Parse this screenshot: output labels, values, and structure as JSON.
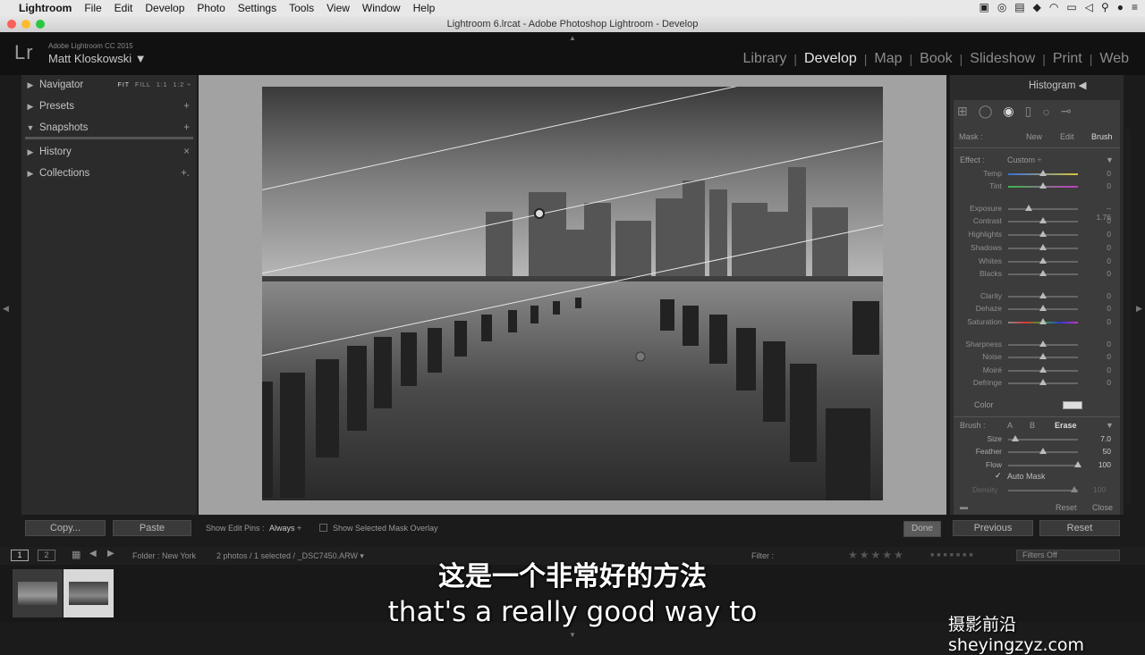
{
  "menubar": {
    "apple": "",
    "app": "Lightroom",
    "items": [
      "File",
      "Edit",
      "Develop",
      "Photo",
      "Settings",
      "Tools",
      "View",
      "Window",
      "Help"
    ]
  },
  "window": {
    "title": "Lightroom 6.lrcat - Adobe Photoshop Lightroom - Develop"
  },
  "identity": {
    "logo": "Lr",
    "product": "Adobe Lightroom CC 2015",
    "user": "Matt Kloskowski ▼"
  },
  "modules": [
    "Library",
    "Develop",
    "Map",
    "Book",
    "Slideshow",
    "Print",
    "Web"
  ],
  "active_module": "Develop",
  "left_panel": {
    "navigator": "Navigator",
    "nav_zoom": [
      "FIT",
      "FILL",
      "1:1",
      "1:2 ÷"
    ],
    "presets": "Presets",
    "snapshots": "Snapshots",
    "history": "History",
    "collections": "Collections",
    "copy": "Copy...",
    "paste": "Paste"
  },
  "right_panel": {
    "histogram": "Histogram ◀",
    "mask_label": "Mask :",
    "mask_new": "New",
    "mask_edit": "Edit",
    "mask_brush": "Brush",
    "effect_label": "Effect :",
    "effect_value": "Custom ÷",
    "sliders": [
      {
        "label": "Temp",
        "value": "0",
        "pos": 0.5
      },
      {
        "label": "Tint",
        "value": "0",
        "pos": 0.5
      },
      {
        "label": "Exposure",
        "value": "– 1.76",
        "pos": 0.3
      },
      {
        "label": "Contrast",
        "value": "0",
        "pos": 0.5
      },
      {
        "label": "Highlights",
        "value": "0",
        "pos": 0.5
      },
      {
        "label": "Shadows",
        "value": "0",
        "pos": 0.5
      },
      {
        "label": "Whites",
        "value": "0",
        "pos": 0.5
      },
      {
        "label": "Blacks",
        "value": "0",
        "pos": 0.5
      },
      {
        "label": "Clarity",
        "value": "0",
        "pos": 0.5
      },
      {
        "label": "Dehaze",
        "value": "0",
        "pos": 0.5
      },
      {
        "label": "Saturation",
        "value": "0",
        "pos": 0.5
      },
      {
        "label": "Sharpness",
        "value": "0",
        "pos": 0.5
      },
      {
        "label": "Noise",
        "value": "0",
        "pos": 0.5
      },
      {
        "label": "Moiré",
        "value": "0",
        "pos": 0.5
      },
      {
        "label": "Defringe",
        "value": "0",
        "pos": 0.5
      }
    ],
    "color_label": "Color",
    "brush_label": "Brush :",
    "brush_a": "A",
    "brush_b": "B",
    "brush_erase": "Erase",
    "brush_sliders": [
      {
        "label": "Size",
        "value": "7.0",
        "pos": 0.1
      },
      {
        "label": "Feather",
        "value": "50",
        "pos": 0.5
      },
      {
        "label": "Flow",
        "value": "100",
        "pos": 1.0
      }
    ],
    "auto_mask": "Auto Mask",
    "density": "Density",
    "density_value": "100",
    "reset_small": "Reset",
    "close_small": "Close",
    "previous": "Previous",
    "reset": "Reset"
  },
  "toolbar": {
    "show_edit_pins_label": "Show Edit Pins :",
    "show_edit_pins_value": "Always ÷",
    "show_mask_overlay": "Show Selected Mask Overlay",
    "done": "Done"
  },
  "filmstrip": {
    "screen1": "1",
    "screen2": "2",
    "folder": "Folder : New York",
    "count": "2 photos / 1 selected / _DSC7450.ARW ▾",
    "filter_label": "Filter :",
    "filters_off": "Filters Off"
  },
  "subtitles": {
    "zh": "这是一个非常好的方法",
    "en": "that's a really good way to"
  },
  "watermark": "摄影前沿 sheyingzyz.com"
}
